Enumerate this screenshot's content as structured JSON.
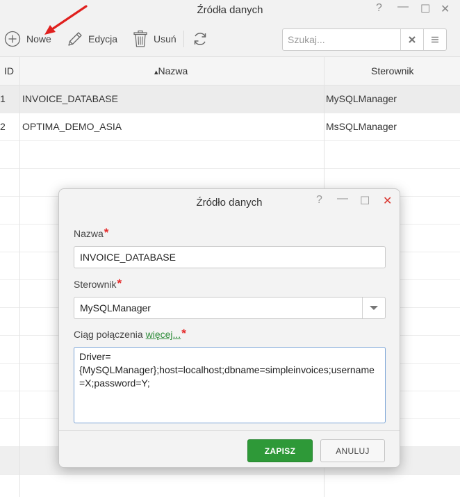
{
  "window": {
    "title": "Źródła danych",
    "help": "?",
    "minimize": "—",
    "maximize": "☐",
    "close": "✕"
  },
  "toolbar": {
    "new_label": "Nowe",
    "edit_label": "Edycja",
    "delete_label": "Usuń",
    "search_placeholder": "Szukaj..."
  },
  "grid": {
    "columns": {
      "id": "ID",
      "name": "Nazwa",
      "driver": "Sterownik"
    },
    "sort_indicator": "▴",
    "rows": [
      {
        "id": "1",
        "name": "INVOICE_DATABASE",
        "driver": "MySQLManager"
      },
      {
        "id": "2",
        "name": "OPTIMA_DEMO_ASIA",
        "driver": "MsSQLManager"
      }
    ]
  },
  "dialog": {
    "title": "Źródło danych",
    "help": "?",
    "minimize": "—",
    "maximize": "☐",
    "close": "✕",
    "name_label": "Nazwa",
    "name_value": "INVOICE_DATABASE",
    "driver_label": "Sterownik",
    "driver_value": "MySQLManager",
    "conn_label": "Ciąg połączenia",
    "conn_more": "więcej...",
    "conn_value": "Driver=\n{MySQLManager};host=localhost;dbname=simpleinvoices;username\n=X;password=Y;",
    "required_mark": "*",
    "save_label": "ZAPISZ",
    "cancel_label": "ANULUJ"
  },
  "colors": {
    "accent_green": "#2e9938",
    "required_red": "#e52a2a",
    "annotation_red": "#e0201e"
  }
}
